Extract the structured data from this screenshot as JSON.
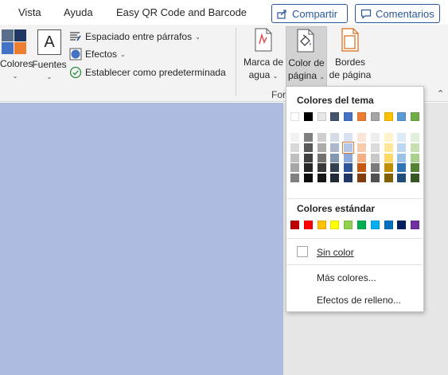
{
  "tabs": [
    "Vista",
    "Ayuda",
    "Easy QR Code and Barcode"
  ],
  "header": {
    "share_label": "Compartir",
    "comments_label": "Comentarios"
  },
  "ribbon": {
    "colors_label": "Colores",
    "fonts_label": "Fuentes",
    "paragraph_spacing_label": "Espaciado entre párrafos",
    "effects_label": "Efectos",
    "set_default_label": "Establecer como predeterminada",
    "watermark_label_1": "Marca de",
    "watermark_label_2": "agua",
    "page_color_label_1": "Color de",
    "page_color_label_2": "página",
    "page_borders_label_1": "Bordes",
    "page_borders_label_2": "de página",
    "group_label": "For",
    "fonts_icon_letter": "A"
  },
  "page_color_hex": "#adbbe0",
  "dropdown": {
    "theme_colors_heading": "Colores del tema",
    "standard_colors_heading": "Colores estándar",
    "no_color_label": "Sin color",
    "more_colors_label": "Más colores...",
    "fill_effects_label": "Efectos de relleno...",
    "theme_colors": [
      "#ffffff",
      "#000000",
      "#e7e6e6",
      "#44546a",
      "#4472c4",
      "#ed7d31",
      "#a5a5a5",
      "#ffc000",
      "#5b9bd5",
      "#70ad47"
    ],
    "theme_shades": [
      [
        "#f2f2f2",
        "#d9d9d9",
        "#bfbfbf",
        "#a6a6a6",
        "#808080"
      ],
      [
        "#808080",
        "#595959",
        "#404040",
        "#262626",
        "#0d0d0d"
      ],
      [
        "#d0cece",
        "#aeabab",
        "#757171",
        "#3a3838",
        "#171616"
      ],
      [
        "#d6dce4",
        "#adb9ca",
        "#8497b0",
        "#333f4f",
        "#222a35"
      ],
      [
        "#d9e1f2",
        "#b4c6e7",
        "#8ea9db",
        "#305496",
        "#203764"
      ],
      [
        "#fce4d6",
        "#f8cbad",
        "#f4b084",
        "#c65911",
        "#833c0c"
      ],
      [
        "#ededed",
        "#dbdbdb",
        "#c9c9c9",
        "#7b7b7b",
        "#525252"
      ],
      [
        "#fff2cc",
        "#ffe699",
        "#ffd966",
        "#bf8f00",
        "#806000"
      ],
      [
        "#ddebf7",
        "#bdd7ee",
        "#9bc2e6",
        "#2f75b5",
        "#1f4e78"
      ],
      [
        "#e2efda",
        "#c6e0b4",
        "#a9d08e",
        "#548235",
        "#375623"
      ]
    ],
    "standard_colors": [
      "#c00000",
      "#ff0000",
      "#ffc000",
      "#ffff00",
      "#92d050",
      "#00b050",
      "#00b0f0",
      "#0070c0",
      "#002060",
      "#7030a0"
    ],
    "selected_shade": {
      "column": 4,
      "row": 1
    }
  }
}
